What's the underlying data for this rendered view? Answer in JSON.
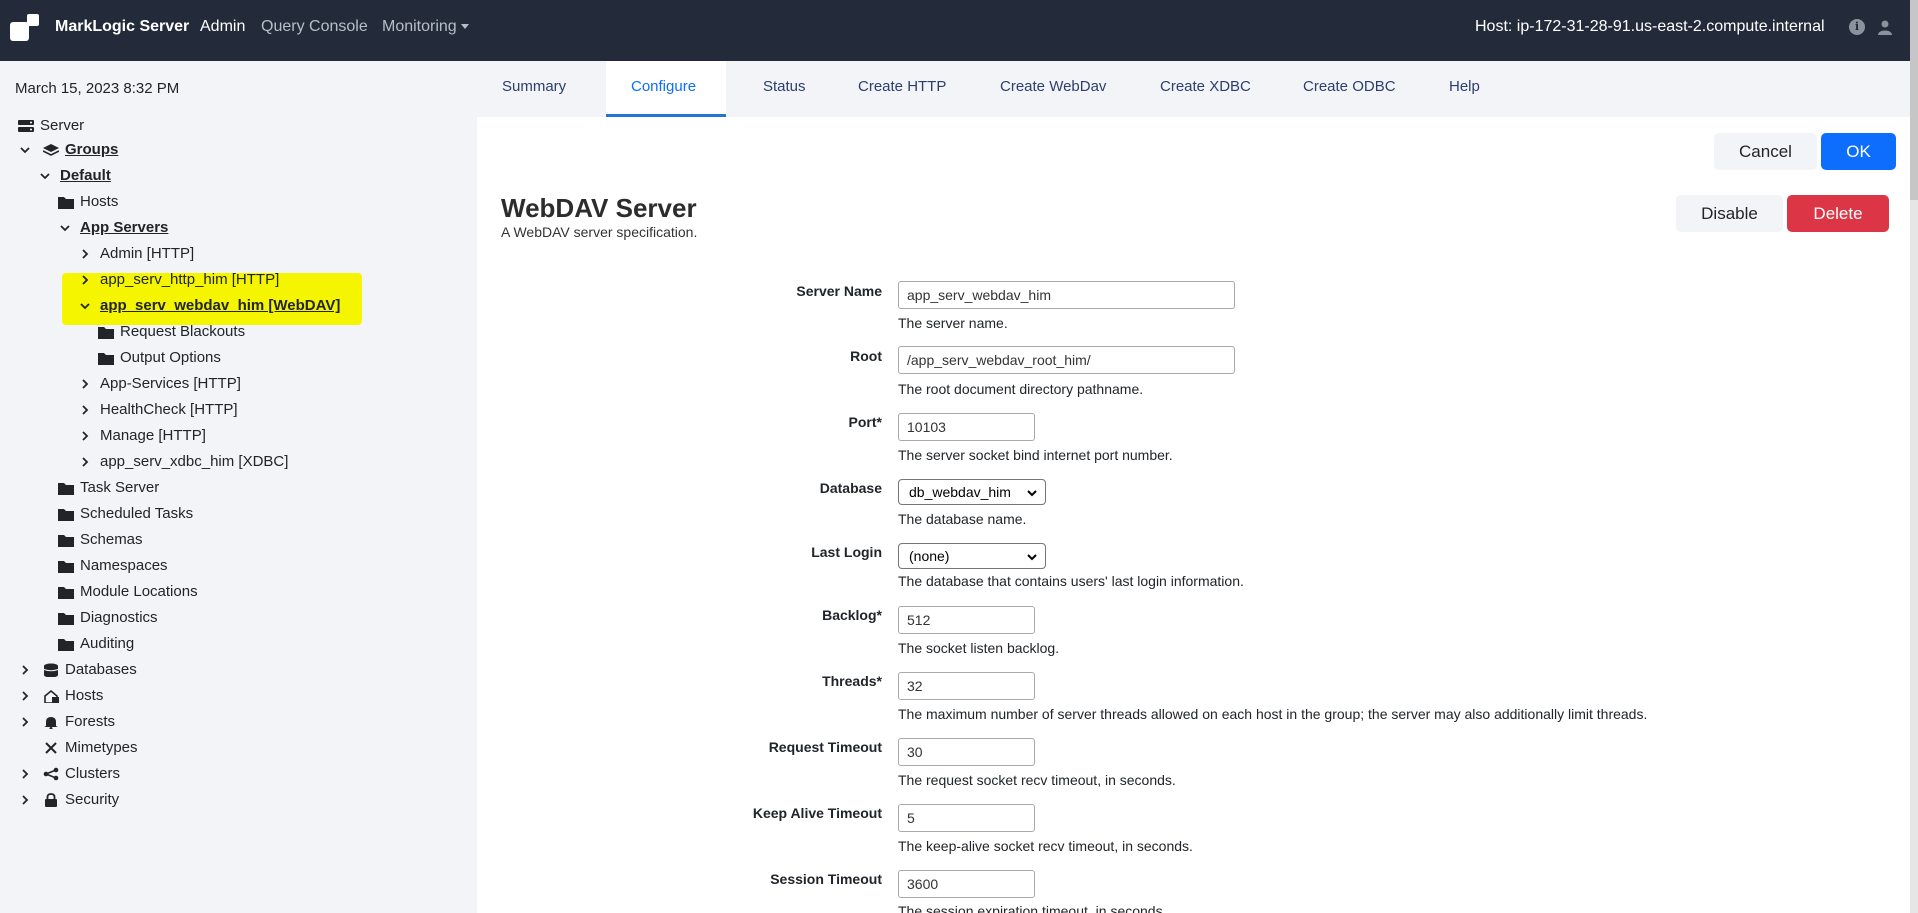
{
  "navbar": {
    "brand": "MarkLogic Server",
    "links": {
      "admin": "Admin",
      "query_console": "Query Console",
      "monitoring": "Monitoring"
    },
    "host": "Host: ip-172-31-28-91.us-east-2.compute.internal"
  },
  "sidebar": {
    "date": "March 15, 2023 8:32 PM",
    "tree": {
      "server": "Server",
      "groups": "Groups",
      "default": "Default",
      "hosts_folder": "Hosts",
      "app_servers": "App Servers",
      "admin_http": "Admin [HTTP]",
      "app_serv_http": "app_serv_http_him [HTTP]",
      "app_serv_webdav": "app_serv_webdav_him [WebDAV]",
      "request_blackouts": "Request Blackouts",
      "output_options": "Output Options",
      "app_services": "App-Services [HTTP]",
      "healthcheck": "HealthCheck [HTTP]",
      "manage": "Manage [HTTP]",
      "app_serv_xdbc": "app_serv_xdbc_him [XDBC]",
      "task_server": "Task Server",
      "scheduled_tasks": "Scheduled Tasks",
      "schemas": "Schemas",
      "namespaces": "Namespaces",
      "module_locations": "Module Locations",
      "diagnostics": "Diagnostics",
      "auditing": "Auditing",
      "databases": "Databases",
      "hosts": "Hosts",
      "forests": "Forests",
      "mimetypes": "Mimetypes",
      "clusters": "Clusters",
      "security": "Security"
    }
  },
  "tabs": {
    "summary": "Summary",
    "configure": "Configure",
    "status": "Status",
    "create_http": "Create HTTP",
    "create_webdav": "Create WebDav",
    "create_xdbc": "Create XDBC",
    "create_odbc": "Create ODBC",
    "help": "Help"
  },
  "buttons": {
    "cancel": "Cancel",
    "ok": "OK",
    "disable": "Disable",
    "delete": "Delete"
  },
  "page": {
    "title": "WebDAV Server",
    "subtitle": "A WebDAV server specification."
  },
  "form": {
    "server_name": {
      "label": "Server Name",
      "value": "app_serv_webdav_him",
      "help": "The server name."
    },
    "root": {
      "label": "Root",
      "value": "/app_serv_webdav_root_him/",
      "help": "The root document directory pathname."
    },
    "port": {
      "label": "Port*",
      "value": "10103",
      "help": "The server socket bind internet port number."
    },
    "database": {
      "label": "Database",
      "value": "db_webdav_him",
      "help": "The database name."
    },
    "last_login": {
      "label": "Last Login",
      "value": "(none)",
      "help": "The database that contains users' last login information."
    },
    "backlog": {
      "label": "Backlog*",
      "value": "512",
      "help": "The socket listen backlog."
    },
    "threads": {
      "label": "Threads*",
      "value": "32",
      "help": "The maximum number of server threads allowed on each host in the group; the server may also additionally limit threads."
    },
    "request_timeout": {
      "label": "Request Timeout",
      "value": "30",
      "help": "The request socket recv timeout, in seconds."
    },
    "keep_alive_timeout": {
      "label": "Keep Alive Timeout",
      "value": "5",
      "help": "The keep-alive socket recv timeout, in seconds."
    },
    "session_timeout": {
      "label": "Session Timeout",
      "value": "3600",
      "help": "The session expiration timeout, in seconds."
    }
  },
  "colors": {
    "navbar_bg": "#232b3a",
    "sidebar_bg": "#f2f4f7",
    "highlight": "#f5f500",
    "primary": "#0d6efd",
    "danger": "#dc3545"
  }
}
